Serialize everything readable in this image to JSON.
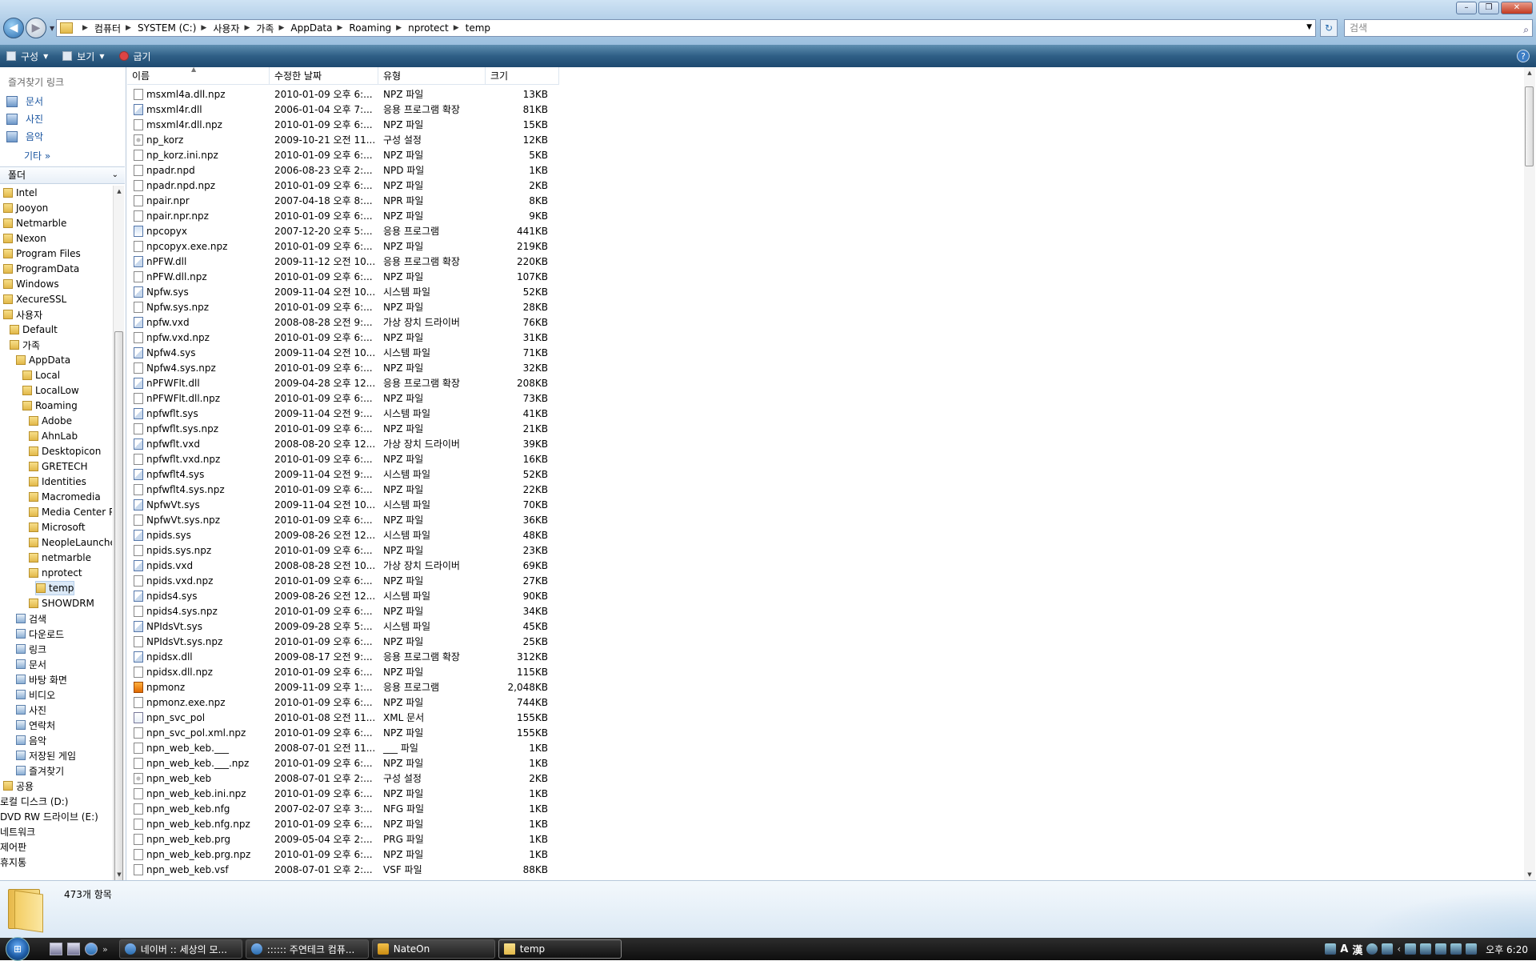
{
  "window": {
    "controls": {
      "minimize": "–",
      "maximize": "❐",
      "close": "✕"
    }
  },
  "address": {
    "crumbs": [
      "컴퓨터",
      "SYSTEM (C:)",
      "사용자",
      "가족",
      "AppData",
      "Roaming",
      "nprotect",
      "temp"
    ],
    "search_placeholder": "검색"
  },
  "toolbar": {
    "organize": "구성",
    "views": "보기",
    "burn": "굽기"
  },
  "favorites": {
    "header": "즐겨찾기 링크",
    "items": [
      "문서",
      "사진",
      "음악"
    ],
    "more": "기타"
  },
  "folders": {
    "header": "폴더",
    "tree": [
      {
        "label": "Intel",
        "depth": 0,
        "kind": "folder"
      },
      {
        "label": "Jooyon",
        "depth": 0,
        "kind": "folder"
      },
      {
        "label": "Netmarble",
        "depth": 0,
        "kind": "folder"
      },
      {
        "label": "Nexon",
        "depth": 0,
        "kind": "folder"
      },
      {
        "label": "Program Files",
        "depth": 0,
        "kind": "folder"
      },
      {
        "label": "ProgramData",
        "depth": 0,
        "kind": "folder"
      },
      {
        "label": "Windows",
        "depth": 0,
        "kind": "folder"
      },
      {
        "label": "XecureSSL",
        "depth": 0,
        "kind": "folder"
      },
      {
        "label": "사용자",
        "depth": 0,
        "kind": "folder"
      },
      {
        "label": "Default",
        "depth": 1,
        "kind": "folder"
      },
      {
        "label": "가족",
        "depth": 1,
        "kind": "folder"
      },
      {
        "label": "AppData",
        "depth": 2,
        "kind": "folder"
      },
      {
        "label": "Local",
        "depth": 3,
        "kind": "folder"
      },
      {
        "label": "LocalLow",
        "depth": 3,
        "kind": "folder"
      },
      {
        "label": "Roaming",
        "depth": 3,
        "kind": "folder"
      },
      {
        "label": "Adobe",
        "depth": 4,
        "kind": "folder"
      },
      {
        "label": "AhnLab",
        "depth": 4,
        "kind": "folder"
      },
      {
        "label": "Desktopicon",
        "depth": 4,
        "kind": "folder"
      },
      {
        "label": "GRETECH",
        "depth": 4,
        "kind": "folder"
      },
      {
        "label": "Identities",
        "depth": 4,
        "kind": "folder"
      },
      {
        "label": "Macromedia",
        "depth": 4,
        "kind": "folder"
      },
      {
        "label": "Media Center Pr",
        "depth": 4,
        "kind": "folder"
      },
      {
        "label": "Microsoft",
        "depth": 4,
        "kind": "folder"
      },
      {
        "label": "NeopleLauncher",
        "depth": 4,
        "kind": "folder"
      },
      {
        "label": "netmarble",
        "depth": 4,
        "kind": "folder"
      },
      {
        "label": "nprotect",
        "depth": 4,
        "kind": "folder"
      },
      {
        "label": "temp",
        "depth": 5,
        "kind": "folder",
        "selected": true
      },
      {
        "label": "SHOWDRM",
        "depth": 4,
        "kind": "folder"
      },
      {
        "label": "검색",
        "depth": 2,
        "kind": "special"
      },
      {
        "label": "다운로드",
        "depth": 2,
        "kind": "special"
      },
      {
        "label": "링크",
        "depth": 2,
        "kind": "special"
      },
      {
        "label": "문서",
        "depth": 2,
        "kind": "special"
      },
      {
        "label": "바탕 화면",
        "depth": 2,
        "kind": "special"
      },
      {
        "label": "비디오",
        "depth": 2,
        "kind": "special"
      },
      {
        "label": "사진",
        "depth": 2,
        "kind": "special"
      },
      {
        "label": "연락처",
        "depth": 2,
        "kind": "special"
      },
      {
        "label": "음악",
        "depth": 2,
        "kind": "special"
      },
      {
        "label": "저장된 게임",
        "depth": 2,
        "kind": "special"
      },
      {
        "label": "즐겨찾기",
        "depth": 2,
        "kind": "special"
      },
      {
        "label": "공용",
        "depth": 0,
        "kind": "folder"
      },
      {
        "label": "로컬 디스크 (D:)",
        "depth": -1,
        "kind": "none"
      },
      {
        "label": "DVD RW 드라이브 (E:)",
        "depth": -1,
        "kind": "none"
      },
      {
        "label": "네트워크",
        "depth": -1,
        "kind": "none"
      },
      {
        "label": "제어판",
        "depth": -1,
        "kind": "none"
      },
      {
        "label": "휴지통",
        "depth": -1,
        "kind": "none"
      }
    ]
  },
  "columns": [
    "이름",
    "수정한 날짜",
    "유형",
    "크기"
  ],
  "files": [
    {
      "name": "msxml4a.dll.npz",
      "date": "2010-01-09 오후 6:...",
      "type": "NPZ 파일",
      "size": "13KB",
      "icon": "file"
    },
    {
      "name": "msxml4r.dll",
      "date": "2006-01-04 오후 7:...",
      "type": "응용 프로그램 확장",
      "size": "81KB",
      "icon": "dll"
    },
    {
      "name": "msxml4r.dll.npz",
      "date": "2010-01-09 오후 6:...",
      "type": "NPZ 파일",
      "size": "15KB",
      "icon": "file"
    },
    {
      "name": "np_korz",
      "date": "2009-10-21 오전 11...",
      "type": "구성 설정",
      "size": "12KB",
      "icon": "cfg"
    },
    {
      "name": "np_korz.ini.npz",
      "date": "2010-01-09 오후 6:...",
      "type": "NPZ 파일",
      "size": "5KB",
      "icon": "file"
    },
    {
      "name": "npadr.npd",
      "date": "2006-08-23 오후 2:...",
      "type": "NPD 파일",
      "size": "1KB",
      "icon": "file"
    },
    {
      "name": "npadr.npd.npz",
      "date": "2010-01-09 오후 6:...",
      "type": "NPZ 파일",
      "size": "2KB",
      "icon": "file"
    },
    {
      "name": "npair.npr",
      "date": "2007-04-18 오후 8:...",
      "type": "NPR 파일",
      "size": "8KB",
      "icon": "file"
    },
    {
      "name": "npair.npr.npz",
      "date": "2010-01-09 오후 6:...",
      "type": "NPZ 파일",
      "size": "9KB",
      "icon": "file"
    },
    {
      "name": "npcopyx",
      "date": "2007-12-20 오후 5:...",
      "type": "응용 프로그램",
      "size": "441KB",
      "icon": "exe"
    },
    {
      "name": "npcopyx.exe.npz",
      "date": "2010-01-09 오후 6:...",
      "type": "NPZ 파일",
      "size": "219KB",
      "icon": "file"
    },
    {
      "name": "nPFW.dll",
      "date": "2009-11-12 오전 10...",
      "type": "응용 프로그램 확장",
      "size": "220KB",
      "icon": "dll"
    },
    {
      "name": "nPFW.dll.npz",
      "date": "2010-01-09 오후 6:...",
      "type": "NPZ 파일",
      "size": "107KB",
      "icon": "file"
    },
    {
      "name": "Npfw.sys",
      "date": "2009-11-04 오전 10...",
      "type": "시스템 파일",
      "size": "52KB",
      "icon": "sys"
    },
    {
      "name": "Npfw.sys.npz",
      "date": "2010-01-09 오후 6:...",
      "type": "NPZ 파일",
      "size": "28KB",
      "icon": "file"
    },
    {
      "name": "npfw.vxd",
      "date": "2008-08-28 오전 9:...",
      "type": "가상 장치 드라이버",
      "size": "76KB",
      "icon": "vxd"
    },
    {
      "name": "npfw.vxd.npz",
      "date": "2010-01-09 오후 6:...",
      "type": "NPZ 파일",
      "size": "31KB",
      "icon": "file"
    },
    {
      "name": "Npfw4.sys",
      "date": "2009-11-04 오전 10...",
      "type": "시스템 파일",
      "size": "71KB",
      "icon": "sys"
    },
    {
      "name": "Npfw4.sys.npz",
      "date": "2010-01-09 오후 6:...",
      "type": "NPZ 파일",
      "size": "32KB",
      "icon": "file"
    },
    {
      "name": "nPFWFlt.dll",
      "date": "2009-04-28 오후 12...",
      "type": "응용 프로그램 확장",
      "size": "208KB",
      "icon": "dll"
    },
    {
      "name": "nPFWFlt.dll.npz",
      "date": "2010-01-09 오후 6:...",
      "type": "NPZ 파일",
      "size": "73KB",
      "icon": "file"
    },
    {
      "name": "npfwflt.sys",
      "date": "2009-11-04 오전 9:...",
      "type": "시스템 파일",
      "size": "41KB",
      "icon": "sys"
    },
    {
      "name": "npfwflt.sys.npz",
      "date": "2010-01-09 오후 6:...",
      "type": "NPZ 파일",
      "size": "21KB",
      "icon": "file"
    },
    {
      "name": "npfwflt.vxd",
      "date": "2008-08-20 오후 12...",
      "type": "가상 장치 드라이버",
      "size": "39KB",
      "icon": "vxd"
    },
    {
      "name": "npfwflt.vxd.npz",
      "date": "2010-01-09 오후 6:...",
      "type": "NPZ 파일",
      "size": "16KB",
      "icon": "file"
    },
    {
      "name": "npfwflt4.sys",
      "date": "2009-11-04 오전 9:...",
      "type": "시스템 파일",
      "size": "52KB",
      "icon": "sys"
    },
    {
      "name": "npfwflt4.sys.npz",
      "date": "2010-01-09 오후 6:...",
      "type": "NPZ 파일",
      "size": "22KB",
      "icon": "file"
    },
    {
      "name": "NpfwVt.sys",
      "date": "2009-11-04 오전 10...",
      "type": "시스템 파일",
      "size": "70KB",
      "icon": "sys"
    },
    {
      "name": "NpfwVt.sys.npz",
      "date": "2010-01-09 오후 6:...",
      "type": "NPZ 파일",
      "size": "36KB",
      "icon": "file"
    },
    {
      "name": "npids.sys",
      "date": "2009-08-26 오전 12...",
      "type": "시스템 파일",
      "size": "48KB",
      "icon": "sys"
    },
    {
      "name": "npids.sys.npz",
      "date": "2010-01-09 오후 6:...",
      "type": "NPZ 파일",
      "size": "23KB",
      "icon": "file"
    },
    {
      "name": "npids.vxd",
      "date": "2008-08-28 오전 10...",
      "type": "가상 장치 드라이버",
      "size": "69KB",
      "icon": "vxd"
    },
    {
      "name": "npids.vxd.npz",
      "date": "2010-01-09 오후 6:...",
      "type": "NPZ 파일",
      "size": "27KB",
      "icon": "file"
    },
    {
      "name": "npids4.sys",
      "date": "2009-08-26 오전 12...",
      "type": "시스템 파일",
      "size": "90KB",
      "icon": "sys"
    },
    {
      "name": "npids4.sys.npz",
      "date": "2010-01-09 오후 6:...",
      "type": "NPZ 파일",
      "size": "34KB",
      "icon": "file"
    },
    {
      "name": "NPIdsVt.sys",
      "date": "2009-09-28 오후 5:...",
      "type": "시스템 파일",
      "size": "45KB",
      "icon": "sys"
    },
    {
      "name": "NPIdsVt.sys.npz",
      "date": "2010-01-09 오후 6:...",
      "type": "NPZ 파일",
      "size": "25KB",
      "icon": "file"
    },
    {
      "name": "npidsx.dll",
      "date": "2009-08-17 오전 9:...",
      "type": "응용 프로그램 확장",
      "size": "312KB",
      "icon": "dll"
    },
    {
      "name": "npidsx.dll.npz",
      "date": "2010-01-09 오후 6:...",
      "type": "NPZ 파일",
      "size": "115KB",
      "icon": "file"
    },
    {
      "name": "npmonz",
      "date": "2009-11-09 오후 1:...",
      "type": "응용 프로그램",
      "size": "2,048KB",
      "icon": "orange"
    },
    {
      "name": "npmonz.exe.npz",
      "date": "2010-01-09 오후 6:...",
      "type": "NPZ 파일",
      "size": "744KB",
      "icon": "file"
    },
    {
      "name": "npn_svc_pol",
      "date": "2010-01-08 오전 11...",
      "type": "XML 문서",
      "size": "155KB",
      "icon": "xml"
    },
    {
      "name": "npn_svc_pol.xml.npz",
      "date": "2010-01-09 오후 6:...",
      "type": "NPZ 파일",
      "size": "155KB",
      "icon": "file"
    },
    {
      "name": "npn_web_keb.___",
      "date": "2008-07-01 오전 11...",
      "type": "___ 파일",
      "size": "1KB",
      "icon": "file"
    },
    {
      "name": "npn_web_keb.___.npz",
      "date": "2010-01-09 오후 6:...",
      "type": "NPZ 파일",
      "size": "1KB",
      "icon": "file"
    },
    {
      "name": "npn_web_keb",
      "date": "2008-07-01 오후 2:...",
      "type": "구성 설정",
      "size": "2KB",
      "icon": "cfg"
    },
    {
      "name": "npn_web_keb.ini.npz",
      "date": "2010-01-09 오후 6:...",
      "type": "NPZ 파일",
      "size": "1KB",
      "icon": "file"
    },
    {
      "name": "npn_web_keb.nfg",
      "date": "2007-02-07 오후 3:...",
      "type": "NFG 파일",
      "size": "1KB",
      "icon": "file"
    },
    {
      "name": "npn_web_keb.nfg.npz",
      "date": "2010-01-09 오후 6:...",
      "type": "NPZ 파일",
      "size": "1KB",
      "icon": "file"
    },
    {
      "name": "npn_web_keb.prg",
      "date": "2009-05-04 오후 2:...",
      "type": "PRG 파일",
      "size": "1KB",
      "icon": "file"
    },
    {
      "name": "npn_web_keb.prg.npz",
      "date": "2010-01-09 오후 6:...",
      "type": "NPZ 파일",
      "size": "1KB",
      "icon": "file"
    },
    {
      "name": "npn_web_keb.vsf",
      "date": "2008-07-01 오후 2:...",
      "type": "VSF 파일",
      "size": "88KB",
      "icon": "file"
    }
  ],
  "details": {
    "count": "473개 항목"
  },
  "taskbar": {
    "start_label": "⊞",
    "quick_more": "»",
    "tasks": [
      {
        "label": "네이버 :: 세상의 모...",
        "icon": "ie"
      },
      {
        "label": ":::::: 주연테크 컴퓨...",
        "icon": "ie"
      },
      {
        "label": "NateOn",
        "icon": "nate"
      },
      {
        "label": "temp",
        "icon": "fold",
        "active": true
      }
    ],
    "ime_a": "A",
    "ime_han": "漢",
    "clock": "오후 6:20"
  }
}
